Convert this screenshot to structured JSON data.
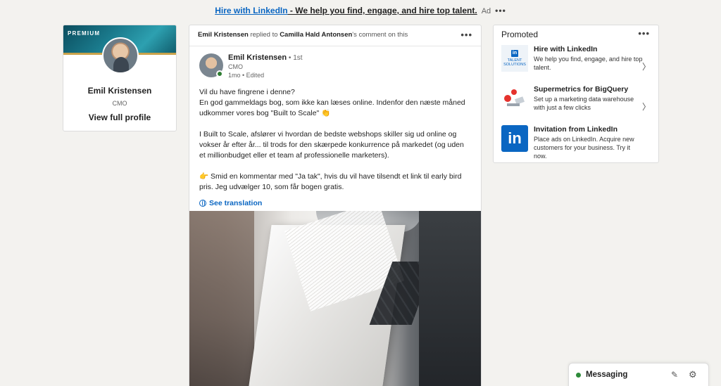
{
  "ad_banner": {
    "link": "Hire with LinkedIn",
    "text": " - We help you find, engage, and hire top talent.",
    "tag": "Ad",
    "more": "•••"
  },
  "profile": {
    "badge": "PREMIUM",
    "name": "Emil Kristensen",
    "title": "CMO",
    "view_label": "View full profile"
  },
  "post": {
    "context_actor": "Emil Kristensen",
    "context_mid": " replied to ",
    "context_target": "Camilla Hald Antonsen",
    "context_end": "'s comment on this",
    "more": "•••",
    "author": {
      "name": "Emil Kristensen",
      "degree": " • 1st",
      "title": "CMO",
      "meta": "1mo • Edited"
    },
    "body": {
      "p1_line1": "Vil du have fingrene i denne?",
      "p1_line2": "En god gammeldags bog, som ikke kan læses online. Indenfor den næste måned udkommer vores bog \"Built to Scale\" 👏",
      "p2": "I Built to Scale, afslører vi hvordan de bedste webshops skiller sig ud online og vokser år efter år... til trods for den skærpede konkurrence på markedet (og uden et millionbudget eller et team af professionelle marketers).",
      "p3": "👉 Smid en kommentar med \"Ja tak\", hvis du vil have tilsendt et link til early bird pris. Jeg udvælger 10, som får bogen gratis."
    },
    "translation_label": "See translation"
  },
  "promoted": {
    "title": "Promoted",
    "more": "•••",
    "items": [
      {
        "name": "Hire with LinkedIn",
        "description": "We help you find, engage, and hire top talent.",
        "logo_badge": "in",
        "logo_text": "TALENT SOLUTIONS",
        "chevron": "〉"
      },
      {
        "name": "Supermetrics for BigQuery",
        "description": "Set up a marketing data warehouse with just a few clicks",
        "chevron": "〉"
      },
      {
        "name": "Invitation from LinkedIn",
        "description": "Place ads on LinkedIn. Acquire new customers for your business. Try it now.",
        "logo_badge": "in"
      }
    ]
  },
  "messaging": {
    "label": "Messaging",
    "compose_icon": "✎",
    "settings_icon": "⚙"
  }
}
